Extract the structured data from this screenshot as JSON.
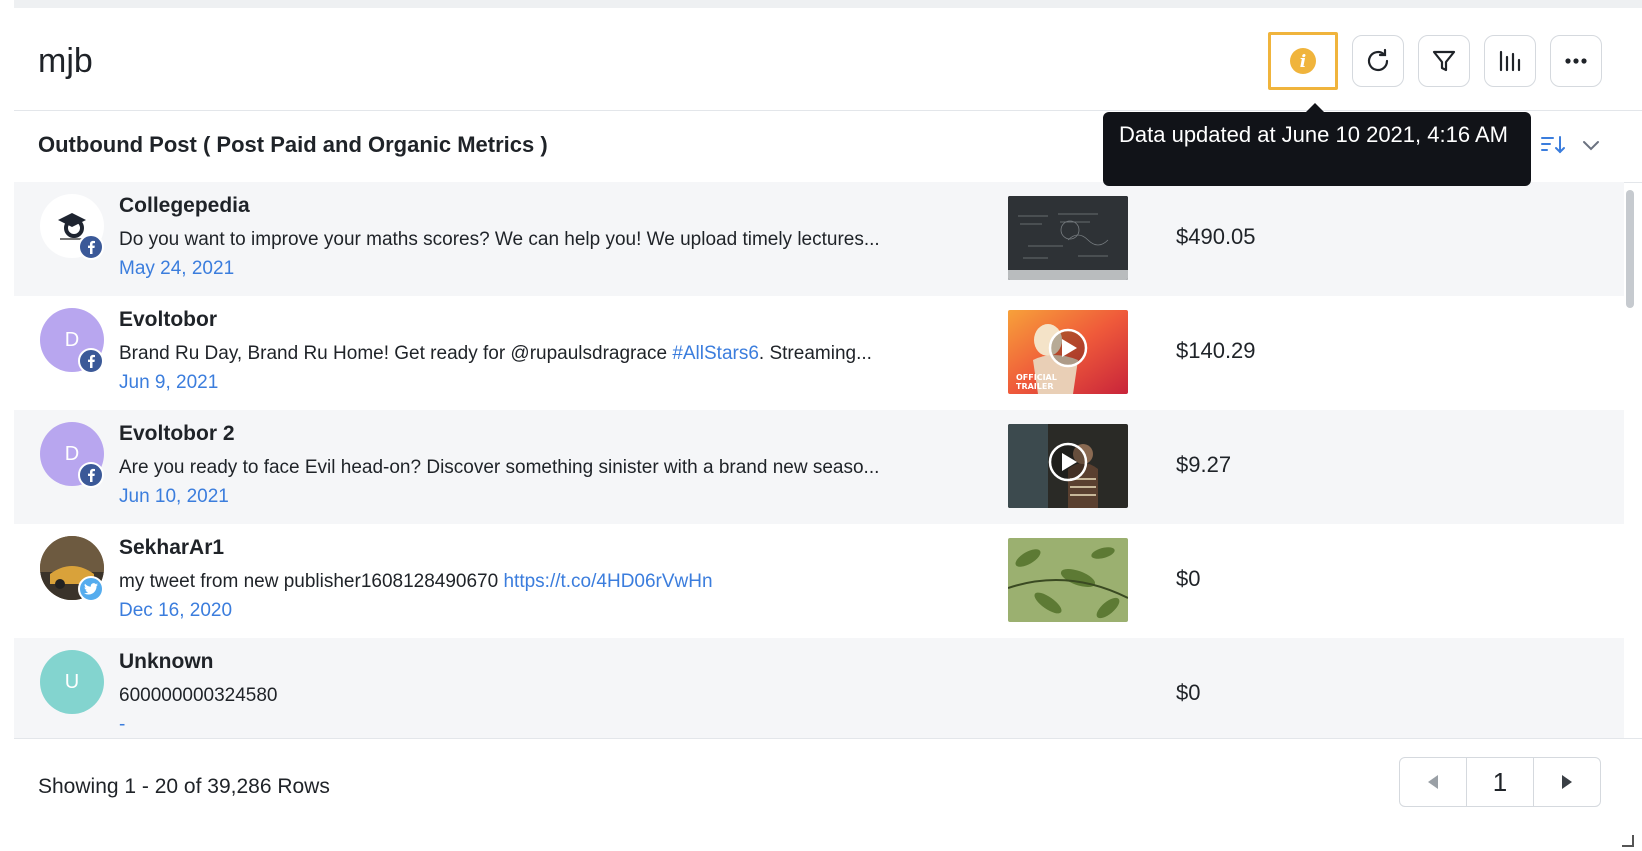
{
  "header": {
    "title": "mjb"
  },
  "toolbar": {
    "info_icon": "info-icon",
    "refresh_icon": "refresh-icon",
    "filter_icon": "filter-icon",
    "chart_icon": "bar-chart-icon",
    "more_icon": "more-icon"
  },
  "tooltip": {
    "text": "Data updated at June 10 2021, 4:16 AM"
  },
  "widget": {
    "title": "Outbound Post ( Post Paid and Organic Metrics )"
  },
  "rows": [
    {
      "account": "Collegepedia",
      "network": "facebook",
      "avatar_letter": "",
      "avatar_color": "#ffffff",
      "text": "Do you want to improve your maths scores? We can help you! We upload timely lectures...",
      "link": "",
      "date": "May 24, 2021",
      "value": "$490.05",
      "thumb": "chalkboard"
    },
    {
      "account": "Evoltobor",
      "network": "facebook",
      "avatar_letter": "D",
      "avatar_color": "#b8a6ef",
      "text": "Brand Ru Day, Brand Ru Home! Get ready for @rupaulsdragrace ",
      "link": "#AllStars6",
      "text_after": ". Streaming...",
      "date": "Jun 9, 2021",
      "value": "$140.29",
      "thumb": "trailer"
    },
    {
      "account": "Evoltobor 2",
      "network": "facebook",
      "avatar_letter": "D",
      "avatar_color": "#b8a6ef",
      "text": "Are you ready to face Evil head-on? Discover something sinister with a brand new seaso...",
      "link": "",
      "date": "Jun 10, 2021",
      "value": "$9.27",
      "thumb": "video-dark"
    },
    {
      "account": "SekharAr1",
      "network": "twitter",
      "avatar_letter": "",
      "avatar_color": "#8a6d4a",
      "text": "my tweet from new publisher1608128490670 ",
      "link": "https://t.co/4HD06rVwHn",
      "date": "Dec 16, 2020",
      "value": "$0",
      "thumb": "leaves"
    },
    {
      "account": "Unknown",
      "network": "",
      "avatar_letter": "U",
      "avatar_color": "#83d4cf",
      "text": "600000000324580",
      "link": "",
      "date": "-",
      "value": "$0",
      "thumb": ""
    }
  ],
  "footer": {
    "showing": "Showing 1 - 20 of 39,286 Rows",
    "page": "1"
  },
  "colors": {
    "accent": "#3b7ddd",
    "highlight": "#f0b43c",
    "facebook": "#3b5998",
    "twitter": "#55acee"
  }
}
